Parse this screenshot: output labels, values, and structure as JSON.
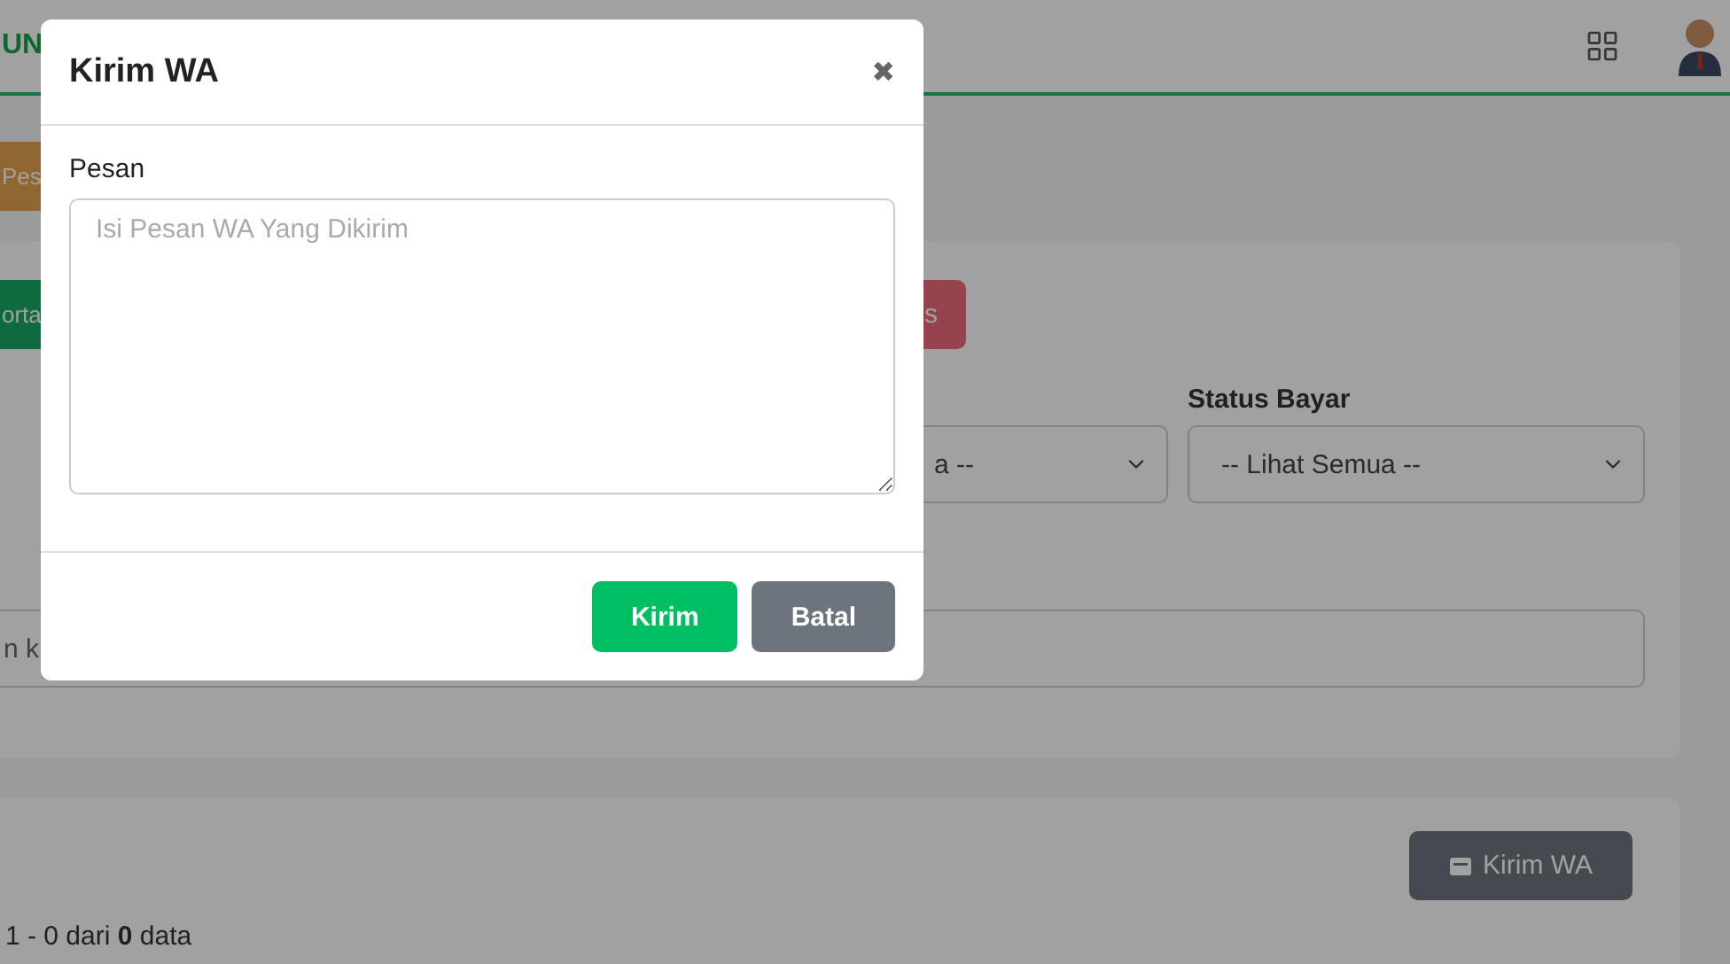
{
  "header": {
    "logo": "UN"
  },
  "page": {
    "top_button": "Pes",
    "filter_card": {
      "buttons": [
        {
          "label": "orta",
          "kind": "success"
        },
        {
          "label": "s",
          "kind": "danger"
        }
      ],
      "filters": [
        {
          "value": "a --"
        },
        {
          "label": "Status Bayar",
          "value": "-- Lihat Semua --"
        }
      ],
      "search": {
        "placeholder": "n k"
      }
    },
    "result_card": {
      "button": "Kirim WA",
      "summary": "1 - 0 dari **0** data"
    }
  },
  "modal": {
    "title": "Kirim WA",
    "close": "✖",
    "field_label": "Pesan",
    "placeholder": "Isi Pesan WA Yang Dikirim",
    "buttons": [
      {
        "label": "Kirim",
        "kind": "primary"
      },
      {
        "label": "Batal",
        "kind": "secondary"
      }
    ]
  }
}
